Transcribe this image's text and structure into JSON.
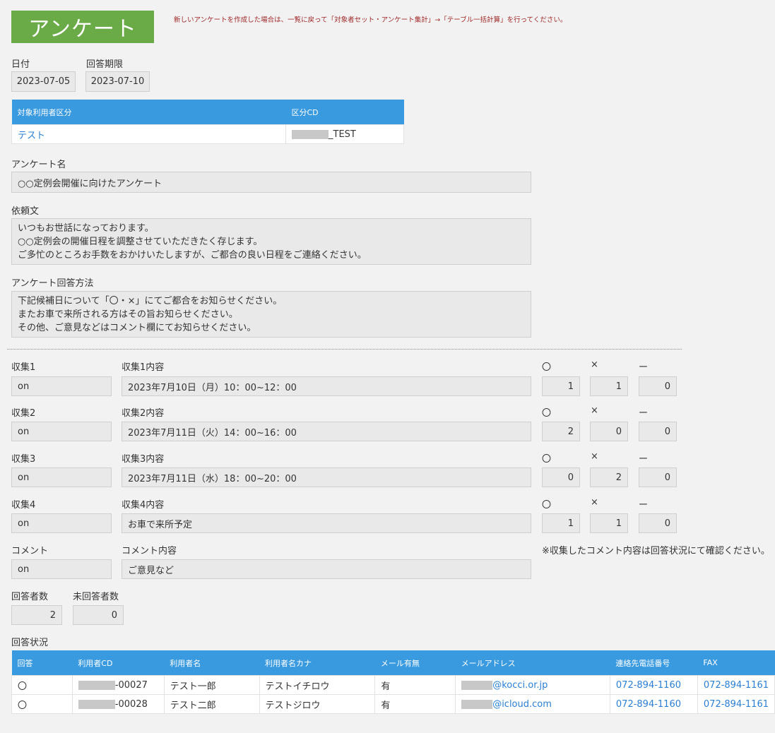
{
  "header": {
    "title": "アンケート",
    "notice": "新しいアンケートを作成した場合は、一覧に戻って「対象者セット・アンケート集計」→「テーブル一括計算」を行ってください。"
  },
  "dates": {
    "date_label": "日付",
    "date_value": "2023-07-05",
    "deadline_label": "回答期限",
    "deadline_value": "2023-07-10"
  },
  "target_table": {
    "headers": [
      "対象利用者区分",
      "区分CD"
    ],
    "row": {
      "category": "テスト",
      "code_suffix": "_TEST"
    }
  },
  "survey": {
    "name_label": "アンケート名",
    "name_value": "○○定例会開催に向けたアンケート",
    "request_label": "依頼文",
    "request_lines": [
      "いつもお世話になっております。",
      "○○定例会の開催日程を調整させていただきたく存じます。",
      "ご多忙のところお手数をおかけいたしますが、ご都合の良い日程をご連絡ください。"
    ],
    "method_label": "アンケート回答方法",
    "method_lines": [
      "下記候補日について「〇・×」にてご都合をお知らせください。",
      "またお車で来所される方はその旨お知らせください。",
      "その他、ご意見などはコメント欄にてお知らせください。"
    ]
  },
  "collections": [
    {
      "label": "収集1",
      "content_label": "収集1内容",
      "flag": "on",
      "content": "2023年7月10日（月）10：00~12：00",
      "circle": "1",
      "cross": "1",
      "dash": "0"
    },
    {
      "label": "収集2",
      "content_label": "収集2内容",
      "flag": "on",
      "content": "2023年7月11日（火）14：00~16：00",
      "circle": "2",
      "cross": "0",
      "dash": "0"
    },
    {
      "label": "収集3",
      "content_label": "収集3内容",
      "flag": "on",
      "content": "2023年7月11日（水）18：00~20：00",
      "circle": "0",
      "cross": "2",
      "dash": "0"
    },
    {
      "label": "収集4",
      "content_label": "収集4内容",
      "flag": "on",
      "content": "お車で来所予定",
      "circle": "1",
      "cross": "1",
      "dash": "0"
    }
  ],
  "symbols": {
    "circle": "〇",
    "cross": "×",
    "dash": "ー"
  },
  "comment": {
    "label": "コメント",
    "content_label": "コメント内容",
    "flag": "on",
    "content": "ご意見など",
    "note": "※収集したコメント内容は回答状況にて確認ください。"
  },
  "counts": {
    "answered_label": "回答者数",
    "answered_value": "2",
    "unanswered_label": "未回答者数",
    "unanswered_value": "0"
  },
  "responses": {
    "label": "回答状況",
    "headers": [
      "回答",
      "利用者CD",
      "利用者名",
      "利用者名カナ",
      "メール有無",
      "メールアドレス",
      "連絡先電話番号",
      "FAX"
    ],
    "rows": [
      {
        "answer": "〇",
        "cd_suffix": "-00027",
        "name": "テスト一郎",
        "kana": "テストイチロウ",
        "mail": "有",
        "email_domain": "@kocci.or.jp",
        "phone": "072-894-1160",
        "fax": "072-894-1161"
      },
      {
        "answer": "〇",
        "cd_suffix": "-00028",
        "name": "テスト二郎",
        "kana": "テストジロウ",
        "mail": "有",
        "email_domain": "@icloud.com",
        "phone": "072-894-1160",
        "fax": "072-894-1161"
      }
    ]
  },
  "colors": {
    "accent_green": "#6aab48",
    "table_header_blue": "#3a9ae0",
    "link_blue": "#2a7fd4",
    "notice_red": "#a02828"
  }
}
